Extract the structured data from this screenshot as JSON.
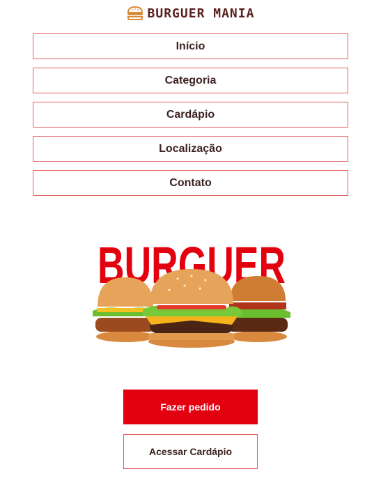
{
  "brand": {
    "name": "BURGUER MANIA",
    "icon": "burger-icon"
  },
  "nav": {
    "items": [
      {
        "label": "Início"
      },
      {
        "label": "Categoria"
      },
      {
        "label": "Cardápio"
      },
      {
        "label": "Localização"
      },
      {
        "label": "Contato"
      }
    ]
  },
  "hero": {
    "title": "BURGUER"
  },
  "actions": {
    "order_label": "Fazer pedido",
    "menu_label": "Acessar Cardápio"
  },
  "colors": {
    "accent": "#e3000f",
    "border": "#e35a5a",
    "text": "#3d2222"
  }
}
